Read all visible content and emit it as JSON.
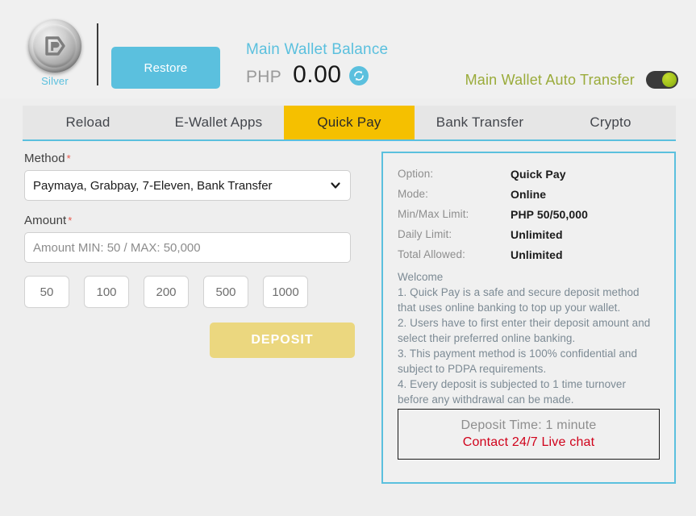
{
  "header": {
    "logo": {
      "icon": "silver-coin-logo-icon",
      "letter": "P",
      "tier_label": "Silver"
    },
    "restore_label": "Restore",
    "balance": {
      "title": "Main Wallet Balance",
      "currency": "PHP",
      "amount": "0.00",
      "refresh_icon": "refresh-icon"
    },
    "auto_transfer": {
      "label": "Main Wallet Auto Transfer",
      "state": "on"
    }
  },
  "tabs": [
    {
      "label": "Reload",
      "active": false
    },
    {
      "label": "E-Wallet Apps",
      "active": false
    },
    {
      "label": "Quick Pay",
      "active": true
    },
    {
      "label": "Bank Transfer",
      "active": false
    },
    {
      "label": "Crypto",
      "active": false
    }
  ],
  "form": {
    "method_label": "Method",
    "method_required": "*",
    "method_value": "Paymaya, Grabpay, 7-Eleven, Bank Transfer",
    "method_chevron_icon": "chevron-down-icon",
    "amount_label": "Amount",
    "amount_required": "*",
    "amount_value": "",
    "amount_placeholder": "Amount MIN: 50 / MAX: 50,000",
    "quick_amounts": [
      "50",
      "100",
      "200",
      "500",
      "1000"
    ],
    "deposit_label": "DEPOSIT"
  },
  "info": {
    "rows": [
      {
        "key": "Option:",
        "value": "Quick Pay"
      },
      {
        "key": "Mode:",
        "value": "Online"
      },
      {
        "key": "Min/Max Limit:",
        "value": "PHP 50/50,000"
      },
      {
        "key": "Daily Limit:",
        "value": "Unlimited"
      },
      {
        "key": "Total Allowed:",
        "value": "Unlimited"
      }
    ],
    "welcome": "Welcome\n1. Quick Pay is a safe and secure deposit method that uses online banking to top up your wallet.\n2. Users have to first enter their deposit amount and select their preferred online banking.\n3. This payment method is 100% confidential and subject to PDPA requirements.\n4. Every deposit is subjected to 1 time turnover before any withdrawal can be made.",
    "note_time": "Deposit Time: 1 minute",
    "note_chat": "Contact 24/7 Live chat"
  },
  "colors": {
    "accent_blue": "#5bc0de",
    "active_tab_gold": "#f5c000",
    "deposit_gold": "#ebd77f",
    "toggle_green": "#9fc01b",
    "alert_red": "#d0021b",
    "auto_transfer_olive": "#9aab3a"
  }
}
